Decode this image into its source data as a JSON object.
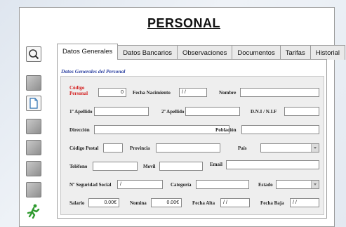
{
  "title": "PERSONAL",
  "toolbar": {
    "icons": [
      "search-icon",
      "blank-tool-icon",
      "document-icon",
      "blank-tool-icon",
      "blank-tool-icon",
      "blank-tool-icon",
      "blank-tool-icon",
      "blank-tool-icon",
      "exit-runner-icon"
    ]
  },
  "tabs": [
    "Datos Generales",
    "Datos Bancarios",
    "Observaciones",
    "Documentos",
    "Tarifas",
    "Historial"
  ],
  "section_label": "Datos Generales del Personal",
  "form": {
    "codigo_label_1": "Código",
    "codigo_label_2": "Personal",
    "codigo_value": "0",
    "fecha_nac_label": "Fecha Nacimiento",
    "fecha_nac_value": "/ /",
    "nombre_label": "Nombre",
    "nombre_value": "",
    "apellido1_label": "1º Apellido",
    "apellido1_value": "",
    "apellido2_label": "2º Apellido",
    "apellido2_value": "",
    "dni_label": "D.N.I / N.I.F",
    "dni_value": "",
    "direccion_label": "Dirección",
    "direccion_value": "",
    "poblacion_label": "Población",
    "poblacion_value": "",
    "cp_label": "Código Postal",
    "cp_value": "",
    "provincia_label": "Provincia",
    "provincia_value": "",
    "pais_label": "País",
    "pais_value": "",
    "telefono_label": "Teléfono",
    "telefono_value": "",
    "movil_label": "Movil",
    "movil_value": "",
    "email_label": "Email",
    "email_value": "",
    "nss_label": "Nº Seguridad Social",
    "nss_value": "/",
    "categoria_label": "Categoría",
    "categoria_value": "",
    "estado_label": "Estado",
    "estado_value": "",
    "salario_label": "Salario",
    "salario_value": "0.00€",
    "nomina_label": "Nomina",
    "nomina_value": "0.00€",
    "fecha_alta_label": "Fecha Alta",
    "fecha_alta_value": "/ /",
    "fecha_baja_label": "Fecha Baja",
    "fecha_baja_value": "/ /"
  }
}
